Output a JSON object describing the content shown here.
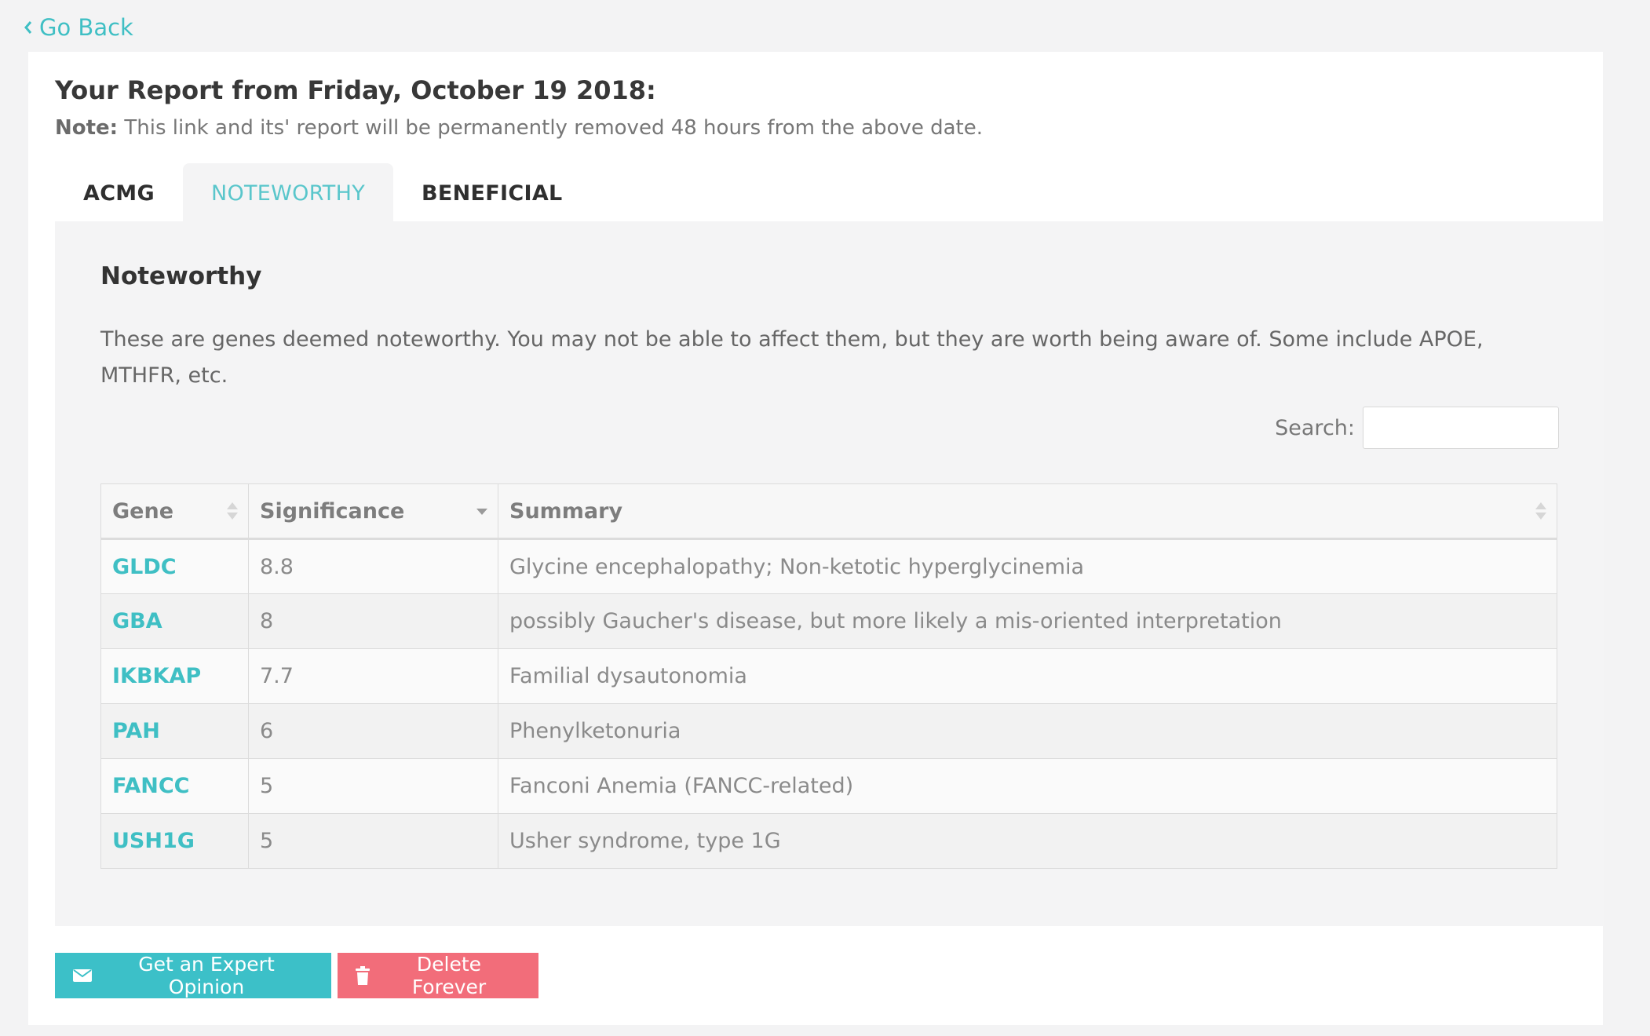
{
  "nav": {
    "go_back": "Go Back"
  },
  "report": {
    "title": "Your Report from Friday, October 19 2018:",
    "note_label": "Note:",
    "note_text": " This link and its' report will be permanently removed 48 hours from the above date."
  },
  "tabs": [
    {
      "label": "ACMG",
      "active": false
    },
    {
      "label": "NOTEWORTHY",
      "active": true
    },
    {
      "label": "BENEFICIAL",
      "active": false
    }
  ],
  "panel": {
    "title": "Noteworthy",
    "description": "These are genes deemed noteworthy. You may not be able to affect them, but they are worth being aware of. Some include APOE, MTHFR, etc."
  },
  "search": {
    "label": "Search:",
    "value": "",
    "placeholder": ""
  },
  "table": {
    "columns": [
      {
        "label": "Gene",
        "sort": "both"
      },
      {
        "label": "Significance",
        "sort": "desc"
      },
      {
        "label": "Summary",
        "sort": "both"
      }
    ],
    "rows": [
      {
        "gene": "GLDC",
        "significance": "8.8",
        "summary": "Glycine encephalopathy; Non-ketotic hyperglycinemia"
      },
      {
        "gene": "GBA",
        "significance": "8",
        "summary": "possibly Gaucher's disease, but more likely a mis-oriented interpretation"
      },
      {
        "gene": "IKBKAP",
        "significance": "7.7",
        "summary": "Familial dysautonomia"
      },
      {
        "gene": "PAH",
        "significance": "6",
        "summary": "Phenylketonuria"
      },
      {
        "gene": "FANCC",
        "significance": "5",
        "summary": "Fanconi Anemia (FANCC-related)"
      },
      {
        "gene": "USH1G",
        "significance": "5",
        "summary": "Usher syndrome, type 1G"
      }
    ]
  },
  "actions": {
    "expert_label": "Get an Expert Opinion",
    "expert_icon": "envelope-icon",
    "delete_label": "Delete Forever",
    "delete_icon": "trash-icon"
  },
  "colors": {
    "accent": "#3fbfc4",
    "expert_button": "#3cc0c8",
    "delete_button": "#f26d7a"
  }
}
